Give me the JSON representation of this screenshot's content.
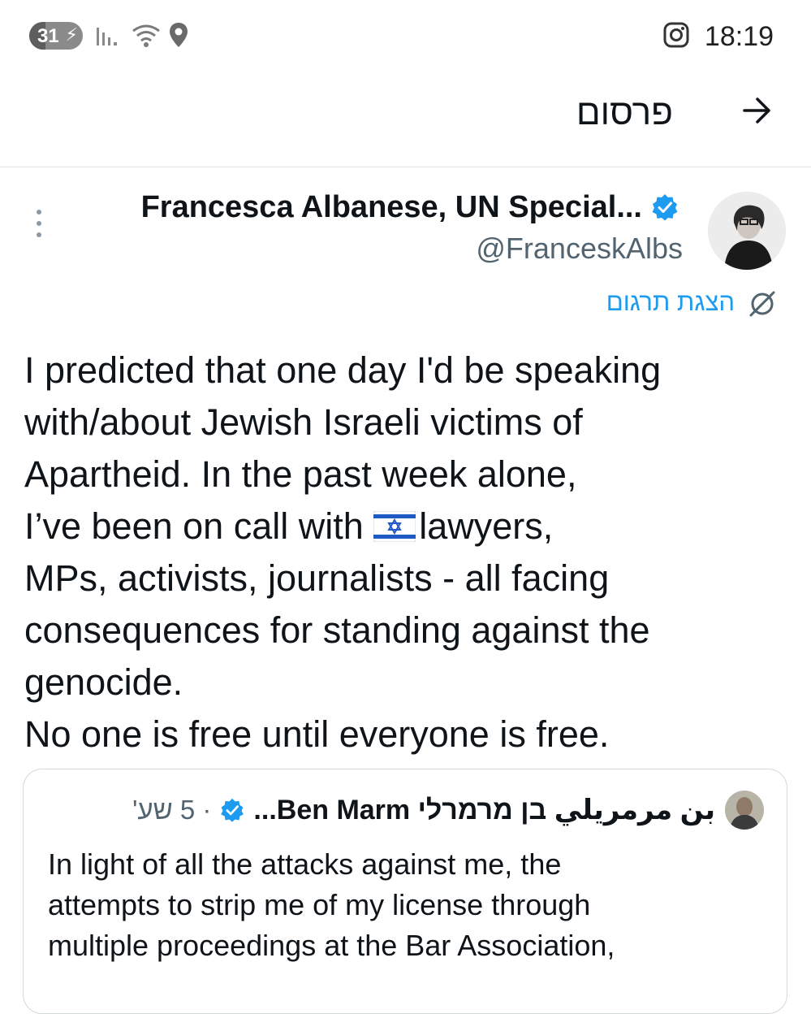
{
  "status_bar": {
    "battery": "31",
    "battery_level_percent": 31,
    "time": "18:19",
    "icons": [
      "charging-bolt-icon",
      "signal-icon",
      "wifi-icon",
      "location-icon",
      "instagram-icon"
    ]
  },
  "header": {
    "title": "פרסום",
    "back_icon": "arrow-right-icon"
  },
  "tweet": {
    "author_name": "Francesca Albanese, UN Special...",
    "handle": "@FranceskAlbs",
    "translate_label": "הצגת תרגום",
    "body_lines": [
      "I predicted that one day I'd be speaking",
      "with/about Jewish Israeli victims of",
      "Apartheid. In the past week alone,",
      "lawyers,",
      "MPs, activists, journalists - all facing",
      "consequences for standing against the",
      "genocide.",
      "No one is free until everyone is free."
    ],
    "line4_prefix": "I’ve been on call with ",
    "flag_icon": "israel-flag-icon"
  },
  "quote": {
    "author_name": "بن مرمريلي בן מרמרלי Ben Marm...",
    "time": "· 5 שע'",
    "text_lines": [
      "In light of all the attacks against me, the",
      "attempts to strip me of my license through",
      "multiple proceedings at the Bar Association,"
    ]
  },
  "colors": {
    "accent": "#1d9bf0",
    "text": "#0f1419",
    "secondary": "#536471",
    "border": "#cfd9de"
  }
}
